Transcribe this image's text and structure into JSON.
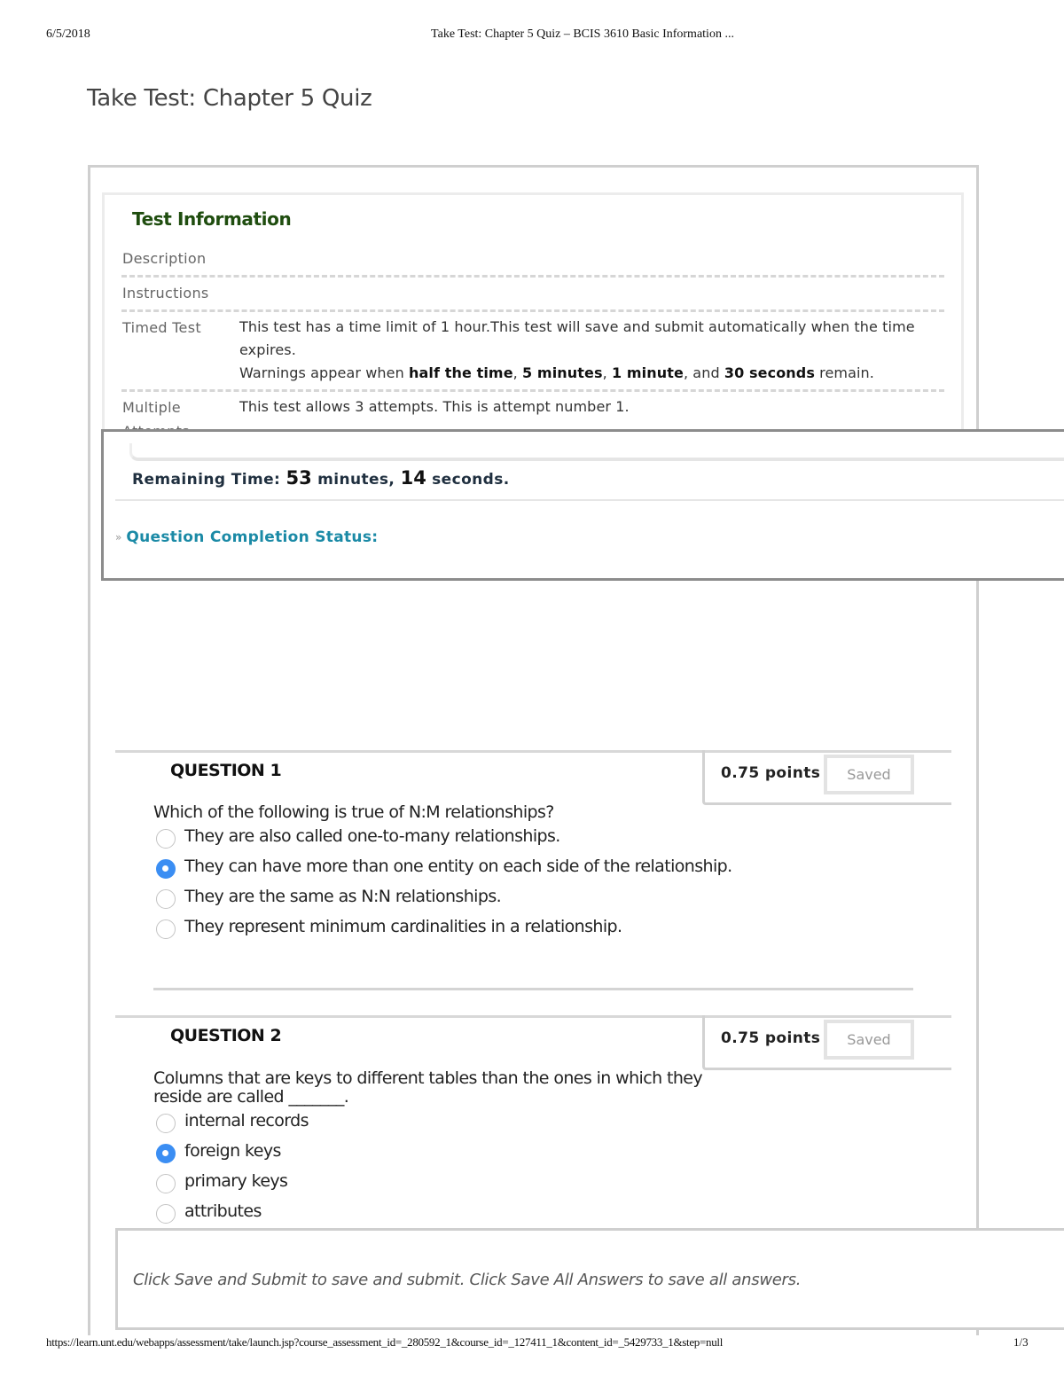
{
  "print_header": {
    "date": "6/5/2018",
    "title": "Take Test: Chapter 5 Quiz – BCIS 3610 Basic Information ..."
  },
  "page_title": "Take Test: Chapter 5 Quiz",
  "test_information": {
    "heading": "Test Information",
    "rows": [
      {
        "label": "Description",
        "value": ""
      },
      {
        "label": "Instructions",
        "value": ""
      },
      {
        "label": "Timed Test",
        "value_line1": "This test has a time limit of 1 hour.This test will save and submit automatically when the time expires.",
        "warnings_prefix": "Warnings appear when ",
        "warnings_bold": [
          "half the time",
          "5 minutes",
          "1 minute",
          "30 seconds"
        ],
        "warnings_sep1": ", ",
        "warnings_sep2": ", ",
        "warnings_sep3": ", and ",
        "warnings_suffix": " remain."
      },
      {
        "label": "Multiple Attempts",
        "value": "This test allows 3 attempts. This is attempt number 1."
      }
    ]
  },
  "timer": {
    "label": "Remaining Time: ",
    "minutes": "53",
    "minutes_unit": " minutes, ",
    "seconds": "14",
    "seconds_unit": " seconds."
  },
  "completion_status": {
    "label": "Question Completion Status:",
    "icon": "double-chevron-down-icon"
  },
  "questions": [
    {
      "title": "QUESTION 1",
      "points": "0.75 points",
      "saved_label": "Saved",
      "text": "Which of the following is true of N:M relationships?",
      "options": [
        {
          "label": "They are also called one-to-many relationships.",
          "selected": false
        },
        {
          "label": "They can have more than one entity on each side of the relationship.",
          "selected": true
        },
        {
          "label": "They are the same as N:N relationships.",
          "selected": false
        },
        {
          "label": "They represent minimum cardinalities in a relationship.",
          "selected": false
        }
      ]
    },
    {
      "title": "QUESTION 2",
      "points": "0.75 points",
      "saved_label": "Saved",
      "text_line1": "Columns that are keys to different tables than the ones in which they",
      "text_line2": "reside are called _______.",
      "options": [
        {
          "label": "internal records",
          "selected": false
        },
        {
          "label": "foreign keys",
          "selected": true
        },
        {
          "label": "primary keys",
          "selected": false
        },
        {
          "label": "attributes",
          "selected": false
        }
      ]
    }
  ],
  "submit_hint": "Click Save and Submit to save and submit. Click Save All Answers to save all answers.",
  "print_footer": {
    "url": "https://learn.unt.edu/webapps/assessment/take/launch.jsp?course_assessment_id=_280592_1&course_id=_127411_1&content_id=_5429733_1&step=null",
    "page": "1/3"
  },
  "colors": {
    "heading_green": "#1f4d0f",
    "link_teal": "#1b8aa6",
    "radio_selected": "#3b8ef3"
  }
}
